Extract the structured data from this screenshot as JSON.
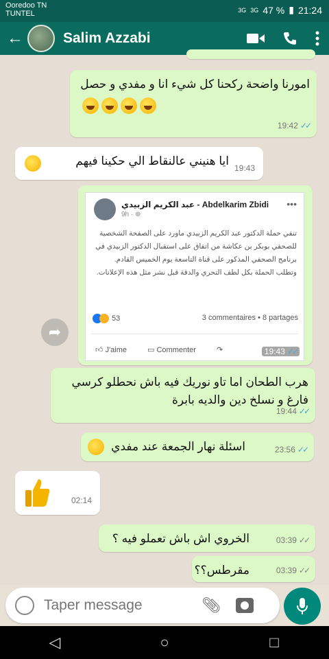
{
  "status": {
    "carrier": "Ooredoo TN",
    "carrier2": "TUNTEL",
    "battery": "47 %",
    "time": "21:24",
    "signal1": "3G",
    "signal2": "3G"
  },
  "header": {
    "contact_name": "Salim Azzabi"
  },
  "messages": [
    {
      "text": "امورنا واضحة ركحنا كل شيء انا و مفدي و حصل",
      "time": "19:42",
      "type": "out"
    },
    {
      "text": "ايا هنيني عالنقاط الي حكينا فيهم",
      "time": "19:43",
      "type": "in"
    },
    {
      "text": "هرب الطحان اما تاو نوريك فيه باش نحطلو كرسي فارغ و نسلخ دين والديه بابرة",
      "time": "19:44",
      "type": "out"
    },
    {
      "text": "اسئلة نهار الجمعة عند مفدي",
      "time": "23:56",
      "type": "out"
    },
    {
      "text": "",
      "time": "02:14",
      "type": "in"
    },
    {
      "text": "الخروي اش باش تعملو فيه ؟",
      "time": "03:39",
      "type": "out"
    },
    {
      "text": "مقرطس؟؟",
      "time": "03:39",
      "type": "out"
    }
  ],
  "shared_post": {
    "author": "عبد الكريم الزبيدي - Abdelkarim Zbidi",
    "sub": "9h · ⊕",
    "body": "تنفي حملة الدكتور عبد الكريم الزبيدي ماورد على الصفحة الشخصية للصحفي بوبكر بن عكاشة من اتفاق على استقبال الدكتور الزبيدي في برنامج الصحفي المذكور على قناة التاسعة يوم الخميس القادم. وتطلب الحملة بكل لطف التحري والدقة قبل نشر مثل هذه الإعلانات.",
    "reactions": "53",
    "comments_shares": "3 commentaires • 8 partages",
    "like_label": "J'aime",
    "comment_label": "Commenter",
    "time": "19:43"
  },
  "input": {
    "placeholder": "Taper message"
  },
  "colors": {
    "header": "#0a6b5f",
    "outgoing": "#dcf8c6",
    "incoming": "#ffffff",
    "mic": "#00897b"
  }
}
